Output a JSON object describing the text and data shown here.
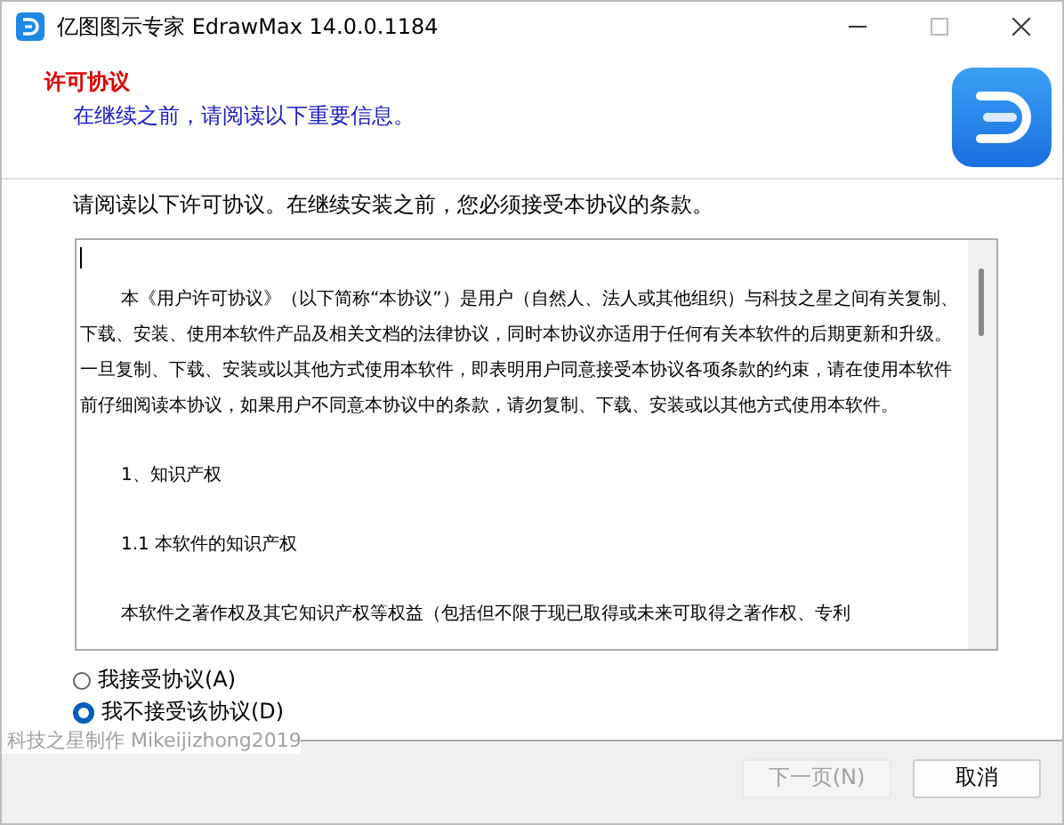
{
  "window": {
    "title": "亿图图示专家 EdrawMax  14.0.0.1184"
  },
  "header": {
    "title": "许可协议",
    "subtitle": "在继续之前，请阅读以下重要信息。"
  },
  "instruction": "请阅读以下许可协议。在继续安装之前，您必须接受本协议的条款。",
  "license_paragraphs": [
    {
      "kind": "indent",
      "text": "本《用户许可协议》（以下简称“本协议”）是用户（自然人、法人或其他组织）与科技之星之间有关复制、下载、安装、使用本软件产品及相关文档的法律协议，同时本协议亦适用于任何有关本软件的后期更新和升级。一旦复制、下载、安装或以其他方式使用本软件，即表明用户同意接受本协议各项条款的约束，请在使用本软件前仔细阅读本协议，如果用户不同意本协议中的条款，请勿复制、下载、安装或以其他方式使用本软件。"
    },
    {
      "kind": "indent",
      "text": "1、知识产权"
    },
    {
      "kind": "indent",
      "text": "1.1 本软件的知识产权"
    },
    {
      "kind": "indent",
      "text": "本软件之著作权及其它知识产权等权益（包括但不限于现已取得或未来可取得之著作权、专利"
    }
  ],
  "options": [
    {
      "label": "我接受协议(A)",
      "selected": false
    },
    {
      "label": "我不接受该协议(D)",
      "selected": true
    }
  ],
  "branding": "科技之星制作  Mikeijizhong2019",
  "buttons": [
    {
      "label": "下一页(N)",
      "disabled": true
    },
    {
      "label": "取消",
      "disabled": false
    }
  ]
}
